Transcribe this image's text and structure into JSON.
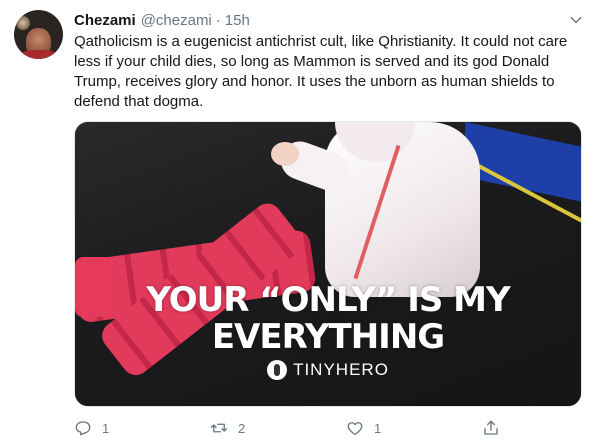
{
  "tweet": {
    "author_name": "Chezami",
    "author_handle": "@chezami",
    "separator": "·",
    "timestamp": "15h",
    "text": "Qatholicism is a eugenicist antichrist cult, like Qhristianity. It could not care less if your child dies, so long as Mammon is served and its god Donald Trump, receives glory and honor.  It uses the unborn as human shields to defend that dogma.",
    "media": {
      "overlay_line1": "YOUR “ONLY” IS MY",
      "overlay_line2": "EVERYTHING",
      "brand_text": "TINYHERO"
    },
    "actions": {
      "reply_count": "1",
      "retweet_count": "2",
      "like_count": "1",
      "reply_icon": "reply-icon",
      "retweet_icon": "retweet-icon",
      "like_icon": "like-icon",
      "share_icon": "share-icon"
    }
  },
  "colors": {
    "text_primary": "#14171a",
    "text_secondary": "#657786",
    "border": "#e1e8ed"
  }
}
